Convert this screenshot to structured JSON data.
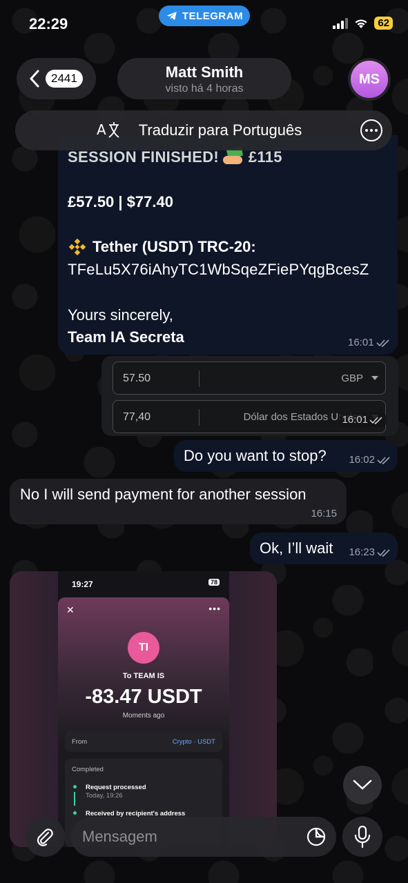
{
  "status_bar": {
    "time": "22:29",
    "app_pill": "TELEGRAM",
    "battery": "62"
  },
  "header": {
    "unread_count": "2441",
    "chat_name": "Matt Smith",
    "chat_status": "visto há 4 horas",
    "avatar_initials": "MS"
  },
  "translate_bar": {
    "label": "Traduzir para Português"
  },
  "messages": {
    "session": {
      "line1": "SESSION FINISHED!",
      "line1_amount": "£115",
      "price": "£57.50 | $77.40",
      "network": "Tether (USDT) TRC-20:",
      "address": "TFeLu5X76iAhyTC1WbSqeZFiePYqgBcesZ",
      "sincerely": "Yours sincerely,",
      "signature": "Team IA Secreta",
      "time": "16:01"
    },
    "converter": {
      "row1_value": "57.50",
      "row1_currency": "GBP",
      "row2_value": "77,40",
      "row2_currency": "Dólar dos Estados Unidos",
      "time": "16:01"
    },
    "stop_question": {
      "text": "Do you want to stop?",
      "time": "16:02"
    },
    "reply_payment": {
      "text": "No I will send payment for another session",
      "time": "16:15"
    },
    "wait": {
      "text": "Ok, I’ll wait",
      "time": "16:23"
    },
    "screenshot": {
      "time": "19:27",
      "battery": "78",
      "avatar": "TI",
      "to": "To TEAM IS",
      "amount": "-83.47 USDT",
      "moments": "Moments ago",
      "from_label": "From",
      "from_value": "Crypto · USDT",
      "completed": "Completed",
      "step1": "Request processed",
      "step1_time": "Today, 19:26",
      "step2": "Received by recipient's address"
    }
  },
  "composer": {
    "placeholder": "Mensagem"
  },
  "colors": {
    "outgoing_bubble": "#0f1628",
    "incoming_bubble": "#1f1f23",
    "telegram_blue": "#2b8be6",
    "battery_yellow": "#f6cd3c",
    "avatar_purple": "#c46ee6"
  }
}
